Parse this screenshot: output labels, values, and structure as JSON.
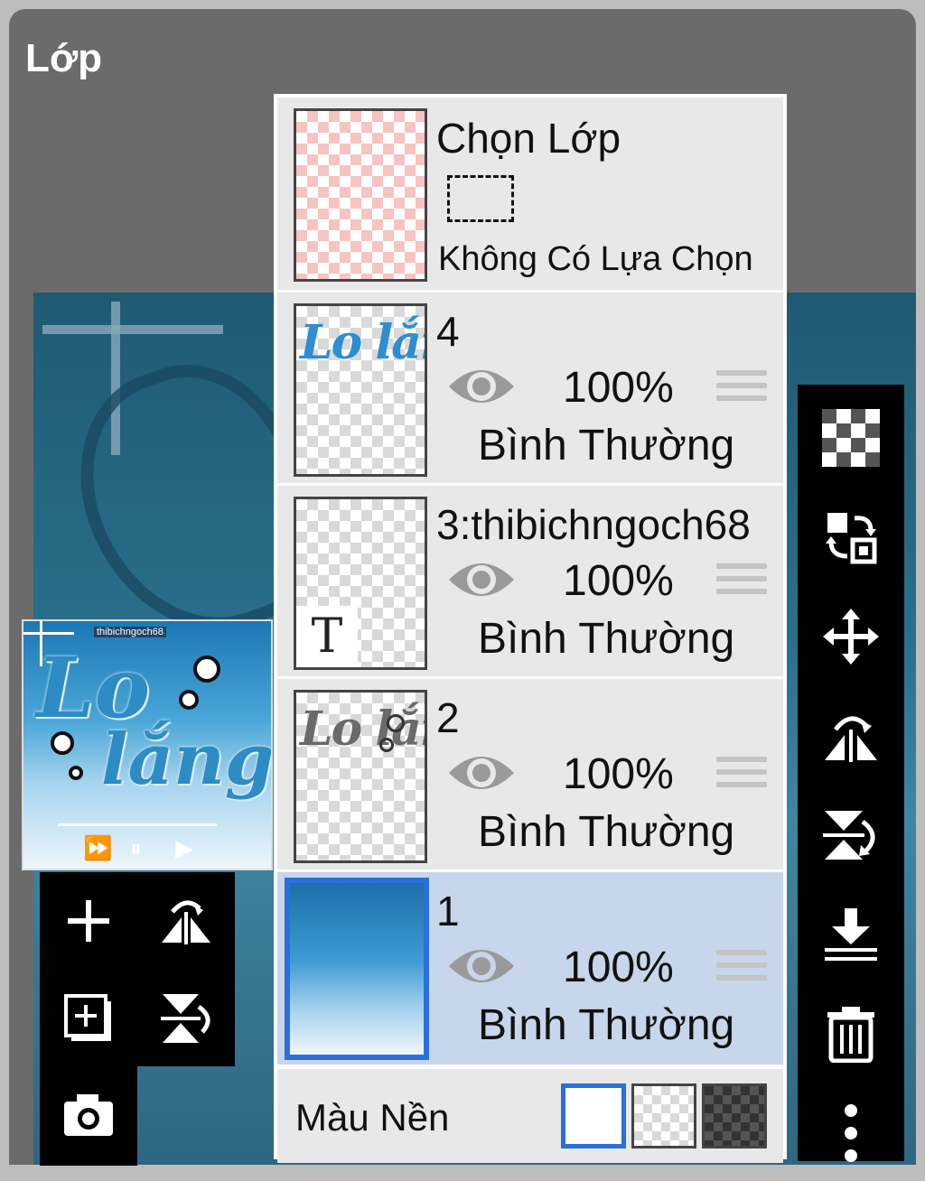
{
  "header": {
    "title": "Lớp"
  },
  "selection_layer": {
    "title": "Chọn Lớp",
    "status": "Không Có Lựa Chọn"
  },
  "layers": [
    {
      "name": "4",
      "opacity": "100%",
      "blend": "Bình Thường",
      "visible": true,
      "selected": false
    },
    {
      "name": "3:thibichngoch68",
      "opacity": "100%",
      "blend": "Bình Thường",
      "visible": true,
      "selected": false
    },
    {
      "name": "2",
      "opacity": "100%",
      "blend": "Bình Thường",
      "visible": true,
      "selected": false
    },
    {
      "name": "1",
      "opacity": "100%",
      "blend": "Bình Thường",
      "visible": true,
      "selected": true
    }
  ],
  "background_color": {
    "label": "Màu Nền",
    "options": [
      "white",
      "transparent",
      "dark-checker"
    ],
    "selected": "white"
  },
  "thumbnails": {
    "layer4_text": "Lo lắng",
    "layer3_glyph": "T",
    "layer2_text": "Lo lắng"
  },
  "preview": {
    "word1": "Lo",
    "word2": "lắng",
    "caption": "thibichngoch68"
  },
  "colors": {
    "selected_row": "#c7d6ea",
    "accent": "#2a6fdb",
    "toolbar": "#000000"
  },
  "left_toolbar": [
    "add-layer-icon",
    "flip-horizontal-icon",
    "add-copy-layer-icon",
    "flip-vertical-icon",
    "camera-icon"
  ],
  "right_toolbar": [
    "transparent-icon",
    "swap-icon",
    "move-icon",
    "flip-h-rotate-icon",
    "flip-v-rotate-icon",
    "merge-down-icon",
    "trash-icon",
    "more-icon"
  ]
}
